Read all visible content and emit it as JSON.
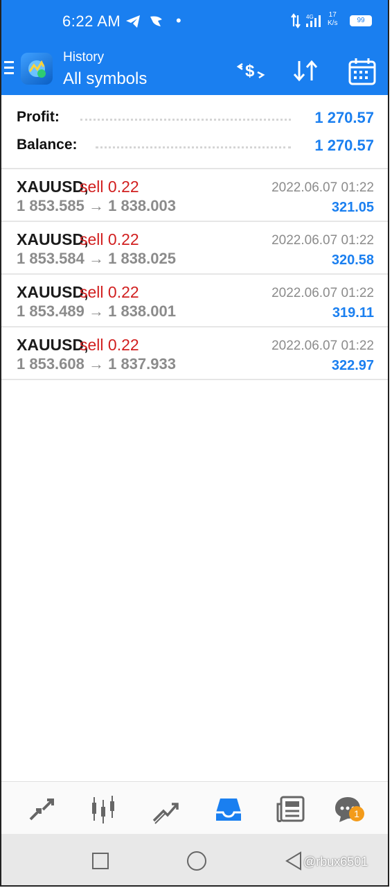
{
  "status_bar": {
    "time": "6:22 AM",
    "network": "4G",
    "speed_value": "17",
    "speed_unit": "K/s",
    "battery": "99"
  },
  "header": {
    "subtitle": "History",
    "title": "All symbols"
  },
  "summary": {
    "profit_label": "Profit:",
    "profit_value": "1 270.57",
    "balance_label": "Balance:",
    "balance_value": "1 270.57"
  },
  "deals": [
    {
      "symbol": "XAUUSD,",
      "side": "sell 0.22",
      "datetime": "2022.06.07 01:22",
      "prices": "1 853.585 → 1 838.003",
      "profit": "321.05"
    },
    {
      "symbol": "XAUUSD,",
      "side": "sell 0.22",
      "datetime": "2022.06.07 01:22",
      "prices": "1 853.584 → 1 838.025",
      "profit": "320.58"
    },
    {
      "symbol": "XAUUSD,",
      "side": "sell 0.22",
      "datetime": "2022.06.07 01:22",
      "prices": "1 853.489 → 1 838.001",
      "profit": "319.11"
    },
    {
      "symbol": "XAUUSD,",
      "side": "sell 0.22",
      "datetime": "2022.06.07 01:22",
      "prices": "1 853.608 → 1 837.933",
      "profit": "322.97"
    }
  ],
  "bottom_nav": {
    "items": [
      "quotes-icon",
      "chart-icon",
      "trade-icon",
      "history-icon",
      "news-icon",
      "chat-icon"
    ],
    "active": "history-icon",
    "chat_badge": "1"
  },
  "watermark": "@rbux6501",
  "colors": {
    "accent": "#1a7ff0",
    "sell": "#d11f1f",
    "muted": "#8b8b8b"
  }
}
